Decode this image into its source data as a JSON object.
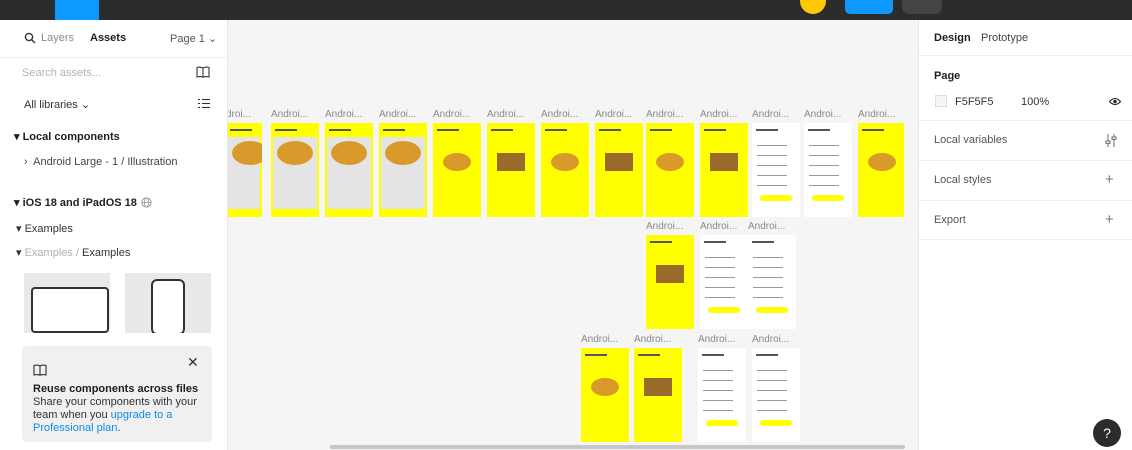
{
  "left_panel": {
    "tab_layers": "Layers",
    "tab_assets": "Assets",
    "page_selector": "Page 1 ⌄",
    "search_placeholder": "Search assets...",
    "all_libraries": "All libraries ⌄",
    "local_components": "Local components",
    "component_item": "Android Large - 1 / Illustration",
    "ios_library": "iOS 18 and iPadOS 18",
    "examples": "Examples",
    "path_parent": "Examples",
    "path_sep": " / ",
    "path_child": "Examples",
    "promo_title": "Reuse components across files",
    "promo_body": "Share your components with your team when you ",
    "promo_link": "upgrade to a Professional plan",
    "promo_end": "."
  },
  "canvas": {
    "frame_label": "Androi...",
    "frame_label_short": "droi...",
    "background": "#F5F5F5"
  },
  "right_panel": {
    "tab_design": "Design",
    "tab_prototype": "Prototype",
    "page_heading": "Page",
    "page_color": "F5F5F5",
    "page_opacity": "100%",
    "local_variables": "Local variables",
    "local_styles": "Local styles",
    "export": "Export",
    "help": "?"
  },
  "colors": {
    "accent": "#0d99ff",
    "frame_yellow": "#ffff00"
  }
}
